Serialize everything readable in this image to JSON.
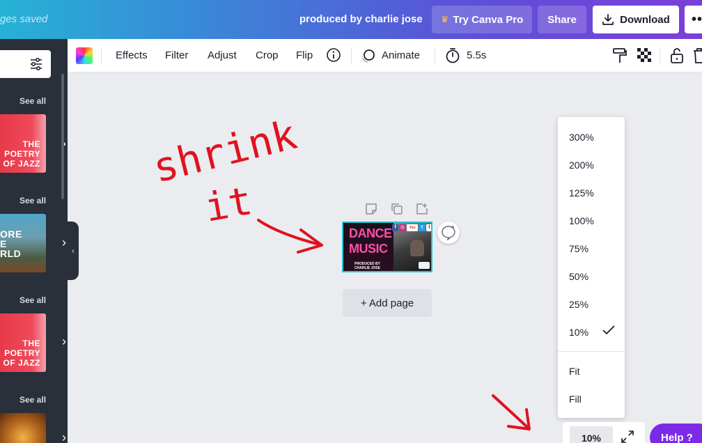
{
  "header": {
    "saved_status": "ges saved",
    "document_title": "produced by charlie jose",
    "try_pro_label": "Try Canva Pro",
    "share_label": "Share",
    "download_label": "Download",
    "more_label": "•••"
  },
  "sidebar": {
    "sections": [
      {
        "see_all": "See all",
        "thumb_text": [
          "THE",
          "POETRY",
          "OF JAZZ"
        ]
      },
      {
        "see_all": "See all",
        "thumb_text": [
          "ORE",
          "E",
          "RLD"
        ]
      },
      {
        "see_all": "See all",
        "thumb_text": [
          "THE",
          "POETRY",
          "OF JAZZ"
        ]
      },
      {
        "see_all": "See all"
      }
    ]
  },
  "toolbar": {
    "effects": "Effects",
    "filter": "Filter",
    "adjust": "Adjust",
    "crop": "Crop",
    "flip": "Flip",
    "animate": "Animate",
    "duration": "5.5s"
  },
  "canvas": {
    "design_title_1": "DANCE",
    "design_title_2": "MUSIC",
    "design_sub_1": "PRODUCED BY",
    "design_sub_2": "CHARLIE JOSE",
    "add_page_label": "+ Add page"
  },
  "zoom_menu": {
    "options": [
      "300%",
      "200%",
      "125%",
      "100%",
      "75%",
      "50%",
      "25%",
      "10%"
    ],
    "selected": "10%",
    "fit_options": [
      "Fit",
      "Fill"
    ]
  },
  "zoom_bar": {
    "value": "10%"
  },
  "help": {
    "label": "Help ?"
  },
  "annotations": {
    "handwritten_line_1": "shrink",
    "handwritten_line_2": "it"
  },
  "colors": {
    "accent": "#7d2ae8",
    "selection": "#22c7d1",
    "annotation": "#e0121e"
  }
}
